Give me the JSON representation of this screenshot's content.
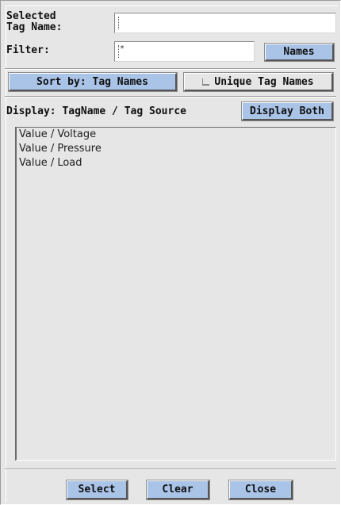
{
  "labels": {
    "selected_tag_name": "Selected\nTag Name:",
    "filter": "Filter:",
    "display": "Display: TagName / Tag Source"
  },
  "fields": {
    "selected_tag_name_value": "",
    "filter_value": "*"
  },
  "buttons": {
    "names": "Names",
    "sort_by": "Sort by: Tag Names",
    "unique_tag_names": "Unique Tag Names",
    "display_both": "Display Both",
    "select": "Select",
    "clear": "Clear",
    "close": "Close"
  },
  "list": {
    "items": [
      "Value / Voltage",
      "Value / Pressure",
      "Value / Load"
    ]
  }
}
